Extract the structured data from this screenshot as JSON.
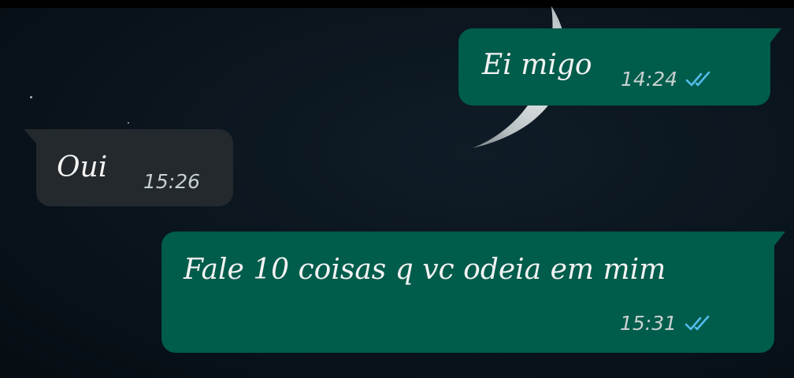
{
  "messages": [
    {
      "direction": "outgoing",
      "text": "Ei migo",
      "time": "14:24",
      "status_icon": "double-check-read-icon"
    },
    {
      "direction": "incoming",
      "text": "Oui",
      "time": "15:26"
    },
    {
      "direction": "outgoing",
      "text": "Fale 10 coisas q vc odeia em mim",
      "time": "15:31",
      "status_icon": "double-check-read-icon"
    }
  ],
  "colors": {
    "background": "#0a141c",
    "outgoing_bubble": "#005c4b",
    "incoming_bubble": "#23292d",
    "read_ticks": "#53bdeb",
    "text": "#f3f3f3",
    "timestamp": "#c8d1d0"
  },
  "wallpaper": {
    "icon": "crescent-moon-icon"
  }
}
